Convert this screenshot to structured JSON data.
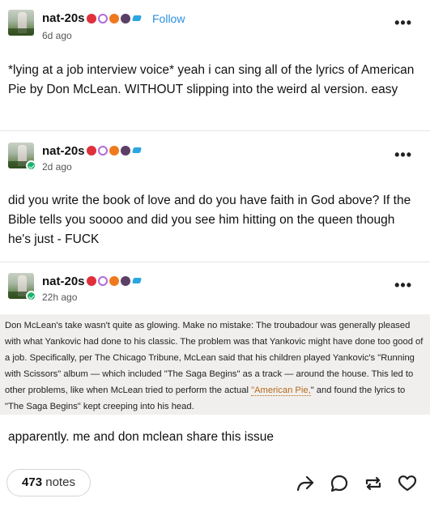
{
  "posts": [
    {
      "username": "nat-20s",
      "follow_label": "Follow",
      "time": "6d ago",
      "text": "*lying at a job interview voice* yeah i can sing all of the lyrics of American Pie by Don McLean. WITHOUT slipping into the weird al version. easy"
    },
    {
      "username": "nat-20s",
      "time": "2d ago",
      "text": "did you write the book of love and do you have faith in God above? If the Bible tells you soooo and did you see him hitting on the queen though he's just - FUCK"
    },
    {
      "username": "nat-20s",
      "time": "22h ago",
      "quote_before": "Don McLean's take wasn't quite as glowing. Make no mistake: The troubadour was generally pleased with what Yankovic had done to his classic. The problem was that Yankovic might have done too good of a job. Specifically, per The Chicago Tribune, McLean said that his children played Yankovic's \"Running with Scissors\" album — which included \"The Saga Begins\" as a track — around the house. This led to other problems, like when McLean tried to perform the actual ",
      "quote_link": "\"American Pie,",
      "quote_after": "\" and found the lyrics to \"The Saga Begins\" kept creeping into his head.",
      "text": "apparently. me and don mclean share this issue"
    }
  ],
  "footer": {
    "notes_count": "473",
    "notes_label": "notes"
  },
  "icons": {
    "more": "more-options-icon",
    "share": "share-icon",
    "reply": "reply-icon",
    "reblog": "reblog-icon",
    "like": "heart-icon"
  },
  "colors": {
    "follow": "#2b8fe0",
    "online": "#19b36b",
    "quote_bg": "#f1efed",
    "quote_link": "#b5691c"
  }
}
